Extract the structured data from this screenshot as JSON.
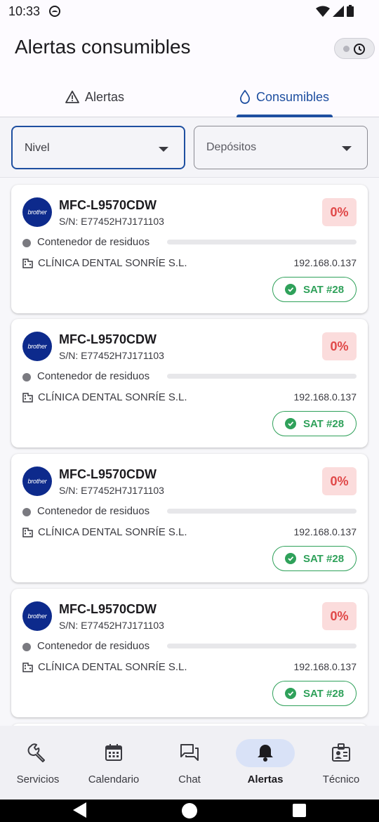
{
  "status_bar": {
    "time": "10:33"
  },
  "header": {
    "title": "Alertas consumibles"
  },
  "tabs": [
    {
      "label": "Alertas",
      "icon": "warning-icon",
      "active": false
    },
    {
      "label": "Consumibles",
      "icon": "drop-icon",
      "active": true
    }
  ],
  "filters": {
    "level_label": "Nivel",
    "deposits_label": "Depósitos"
  },
  "cards": [
    {
      "brand": "brother",
      "model": "MFC-L9570CDW",
      "serial": "S/N: E77452H7J171103",
      "level": "0%",
      "level_value": 0,
      "consumable": "Contenedor de residuos",
      "client": "CLÍNICA DENTAL SONRÍE S.L.",
      "ip": "192.168.0.137",
      "sat": "SAT #28"
    },
    {
      "brand": "brother",
      "model": "MFC-L9570CDW",
      "serial": "S/N: E77452H7J171103",
      "level": "0%",
      "level_value": 0,
      "consumable": "Contenedor de residuos",
      "client": "CLÍNICA DENTAL SONRÍE S.L.",
      "ip": "192.168.0.137",
      "sat": "SAT #28"
    },
    {
      "brand": "brother",
      "model": "MFC-L9570CDW",
      "serial": "S/N: E77452H7J171103",
      "level": "0%",
      "level_value": 0,
      "consumable": "Contenedor de residuos",
      "client": "CLÍNICA DENTAL SONRÍE S.L.",
      "ip": "192.168.0.137",
      "sat": "SAT #28"
    },
    {
      "brand": "brother",
      "model": "MFC-L9570CDW",
      "serial": "S/N: E77452H7J171103",
      "level": "0%",
      "level_value": 0,
      "consumable": "Contenedor de residuos",
      "client": "CLÍNICA DENTAL SONRÍE S.L.",
      "ip": "192.168.0.137",
      "sat": "SAT #28"
    }
  ],
  "bottom_nav": [
    {
      "label": "Servicios",
      "icon": "wrench-icon",
      "active": false
    },
    {
      "label": "Calendario",
      "icon": "calendar-icon",
      "active": false
    },
    {
      "label": "Chat",
      "icon": "chat-icon",
      "active": false
    },
    {
      "label": "Alertas",
      "icon": "bell-icon",
      "active": true
    },
    {
      "label": "Técnico",
      "icon": "technician-icon",
      "active": false
    }
  ],
  "colors": {
    "accent": "#1e4fa0",
    "danger": "#e04848",
    "success": "#2fa15a",
    "brand_logo": "#0d2a8c"
  }
}
